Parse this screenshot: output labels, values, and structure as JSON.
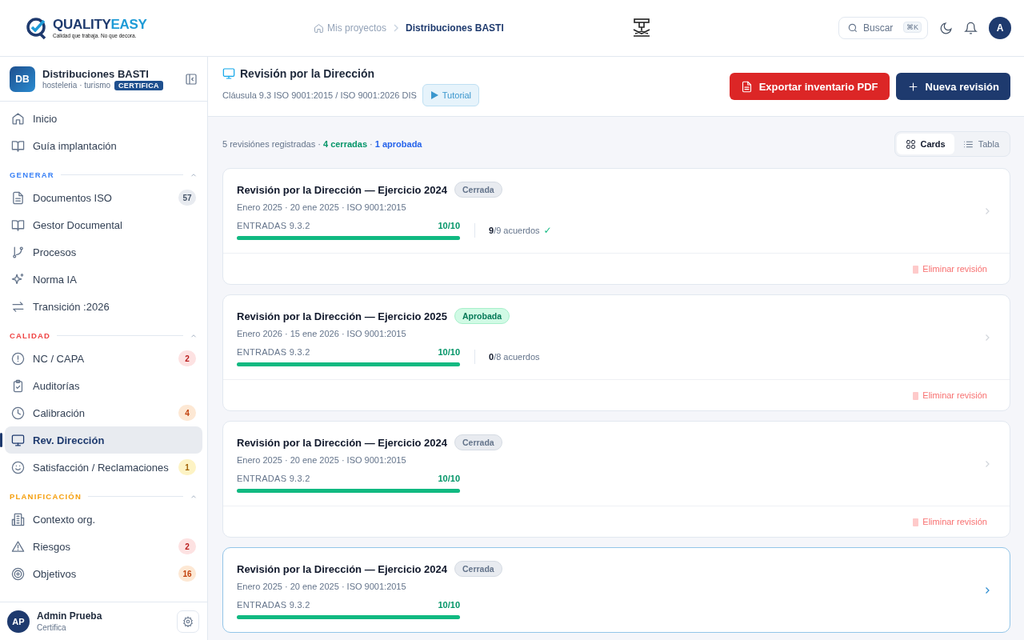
{
  "header": {
    "logo": {
      "name_part_1": "QUALITY",
      "name_part_2": "EASY",
      "tagline": "Calidad que trabaja. No que decora."
    },
    "breadcrumb": [
      {
        "label": "Mis proyectos",
        "selected": false
      },
      {
        "label": "Distribuciones BASTI",
        "selected": true
      }
    ],
    "search": {
      "placeholder": "Buscar",
      "shortcut": "⌘K"
    },
    "avatar": "A"
  },
  "sidebar": {
    "project": {
      "initials": "DB",
      "name": "Distribuciones BASTI",
      "sector": "hosteleria · turismo",
      "plan": "CERTIFICA"
    },
    "top_items": [
      {
        "kind": "home",
        "label": "Inicio",
        "selected": false
      },
      {
        "kind": "book",
        "label": "Guía implantación",
        "selected": false
      }
    ],
    "sections": [
      {
        "title": "GENERAR",
        "color": "#3b82f6",
        "expanded": true,
        "items": [
          {
            "kind": "file",
            "label": "Documentos ISO",
            "selected": false,
            "badge": {
              "text": "57",
              "kind": "neutral"
            }
          },
          {
            "kind": "book",
            "label": "Gestor Documental",
            "selected": false
          },
          {
            "kind": "branch",
            "label": "Procesos",
            "selected": false
          },
          {
            "kind": "sparkles",
            "label": "Norma IA",
            "selected": false
          },
          {
            "kind": "arrows",
            "label": "Transición :2026",
            "selected": false
          }
        ]
      },
      {
        "title": "CALIDAD",
        "color": "#ef4444",
        "expanded": true,
        "items": [
          {
            "kind": "alert",
            "label": "NC / CAPA",
            "selected": false,
            "badge": {
              "text": "2",
              "kind": "danger"
            }
          },
          {
            "kind": "clipboard",
            "label": "Auditorías",
            "selected": false
          },
          {
            "kind": "clock",
            "label": "Calibración",
            "selected": false,
            "badge": {
              "text": "4",
              "kind": "warning"
            }
          },
          {
            "kind": "monitor",
            "label": "Rev. Dirección",
            "selected": true
          },
          {
            "kind": "smile",
            "label": "Satisfacción / Reclamaciones",
            "selected": false,
            "badge": {
              "text": "1",
              "kind": "caution"
            }
          }
        ]
      },
      {
        "title": "PLANIFICACIÓN",
        "color": "#f59e0b",
        "expanded": true,
        "items": [
          {
            "kind": "building",
            "label": "Contexto org.",
            "selected": false
          },
          {
            "kind": "warning",
            "label": "Riesgos",
            "selected": false,
            "badge": {
              "text": "2",
              "kind": "danger"
            }
          },
          {
            "kind": "target",
            "label": "Objetivos",
            "selected": false,
            "badge": {
              "text": "16",
              "kind": "warning"
            }
          }
        ]
      }
    ],
    "user": {
      "initials": "AP",
      "name": "Admin Prueba",
      "role": "Certifica"
    }
  },
  "page": {
    "title": "Revisión por la Dirección",
    "clause": "Cláusula 9.3 ISO 9001:2015 / ISO 9001:2026 DIS",
    "tutorial": "Tutorial",
    "actions": [
      {
        "kind": "export",
        "label": "Exportar inventario PDF"
      },
      {
        "kind": "new",
        "label": "Nueva revisión"
      }
    ]
  },
  "summary": [
    {
      "text": "5 revisiónes registradas · ",
      "kind": "plain"
    },
    {
      "text": "4 cerradas",
      "kind": "success"
    },
    {
      "text": " · ",
      "kind": "plain"
    },
    {
      "text": "1 aprobada",
      "kind": "info"
    }
  ],
  "view_toggle": [
    {
      "kind": "grid",
      "label": "Cards",
      "selected": true
    },
    {
      "kind": "list",
      "label": "Tabla",
      "selected": false
    }
  ],
  "reviews": [
    {
      "title": "Revisión por la Dirección — Ejercicio 2024",
      "status": {
        "label": "Cerrada",
        "kind": "closed"
      },
      "meta": "Enero 2025 · 20 ene 2025 · ISO 9001:2015",
      "inputs_label": "ENTRADAS 9.3.2",
      "inputs_count": "10/10",
      "level": 1,
      "agreements": "**9**/9 acuerdos",
      "agreements_check": "✓",
      "highlighted": false,
      "delete": "Eliminar revisión"
    },
    {
      "title": "Revisión por la Dirección — Ejercicio 2025",
      "status": {
        "label": "Aprobada",
        "kind": "approved"
      },
      "meta": "Enero 2026 · 15 ene 2026 · ISO 9001:2015",
      "inputs_label": "ENTRADAS 9.3.2",
      "inputs_count": "10/10",
      "level": 1,
      "agreements": "**0**/8 acuerdos",
      "highlighted": false,
      "delete": "Eliminar revisión"
    },
    {
      "title": "Revisión por la Dirección — Ejercicio 2024",
      "status": {
        "label": "Cerrada",
        "kind": "closed"
      },
      "meta": "Enero 2025 · 20 ene 2025 · ISO 9001:2015",
      "inputs_label": "ENTRADAS 9.3.2",
      "inputs_count": "10/10",
      "level": 1,
      "highlighted": false,
      "delete": "Eliminar revisión"
    },
    {
      "title": "Revisión por la Dirección — Ejercicio 2024",
      "status": {
        "label": "Cerrada",
        "kind": "closed"
      },
      "meta": "Enero 2025 · 20 ene 2025 · ISO 9001:2015",
      "inputs_label": "ENTRADAS 9.3.2",
      "inputs_count": "10/10",
      "level": 1,
      "highlighted": true
    }
  ]
}
